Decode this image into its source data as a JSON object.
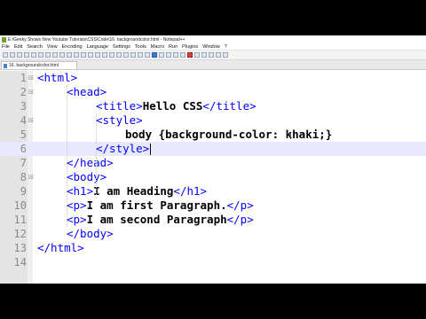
{
  "window": {
    "title": "E:\\Geeky Shows New Youtube Tutorials\\CSS\\Code\\16. backgroundcolor.html - Notepad++"
  },
  "menu": [
    "File",
    "Edit",
    "Search",
    "View",
    "Encoding",
    "Language",
    "Settings",
    "Tools",
    "Macro",
    "Run",
    "Plugins",
    "Window",
    "?"
  ],
  "tab": {
    "label": "16. backgroundcolor.html"
  },
  "editor": {
    "current_line": 6,
    "lines": [
      {
        "num": "1",
        "tok": [
          {
            "t": "<html>",
            "k": "tag"
          }
        ]
      },
      {
        "num": "2",
        "tok": [
          {
            "t": "<head>",
            "k": "tag"
          }
        ]
      },
      {
        "num": "3",
        "tok": [
          {
            "t": "<title>",
            "k": "tag"
          },
          {
            "t": "Hello CSS",
            "k": "text"
          },
          {
            "t": "</title>",
            "k": "tag"
          }
        ]
      },
      {
        "num": "4",
        "tok": [
          {
            "t": "<style>",
            "k": "tag"
          }
        ]
      },
      {
        "num": "5",
        "tok": [
          {
            "t": "body {background-color: khaki;}",
            "k": "text"
          }
        ]
      },
      {
        "num": "6",
        "tok": [
          {
            "t": "</style>",
            "k": "tag"
          }
        ]
      },
      {
        "num": "7",
        "tok": [
          {
            "t": "</head>",
            "k": "tag"
          }
        ]
      },
      {
        "num": "8",
        "tok": [
          {
            "t": "<body>",
            "k": "tag"
          }
        ]
      },
      {
        "num": "9",
        "tok": [
          {
            "t": "<h1>",
            "k": "tag"
          },
          {
            "t": "I am Heading",
            "k": "text"
          },
          {
            "t": "</h1>",
            "k": "tag"
          }
        ]
      },
      {
        "num": "10",
        "tok": [
          {
            "t": "<p>",
            "k": "tag"
          },
          {
            "t": "I am first Paragraph.",
            "k": "text"
          },
          {
            "t": "</p>",
            "k": "tag"
          }
        ]
      },
      {
        "num": "11",
        "tok": [
          {
            "t": "<p>",
            "k": "tag"
          },
          {
            "t": "I am second Paragraph",
            "k": "text"
          },
          {
            "t": "</p>",
            "k": "tag"
          }
        ]
      },
      {
        "num": "12",
        "tok": [
          {
            "t": "</body>",
            "k": "tag"
          }
        ]
      },
      {
        "num": "13",
        "tok": [
          {
            "t": "</html>",
            "k": "tag"
          }
        ]
      },
      {
        "num": "14",
        "tok": []
      }
    ]
  }
}
